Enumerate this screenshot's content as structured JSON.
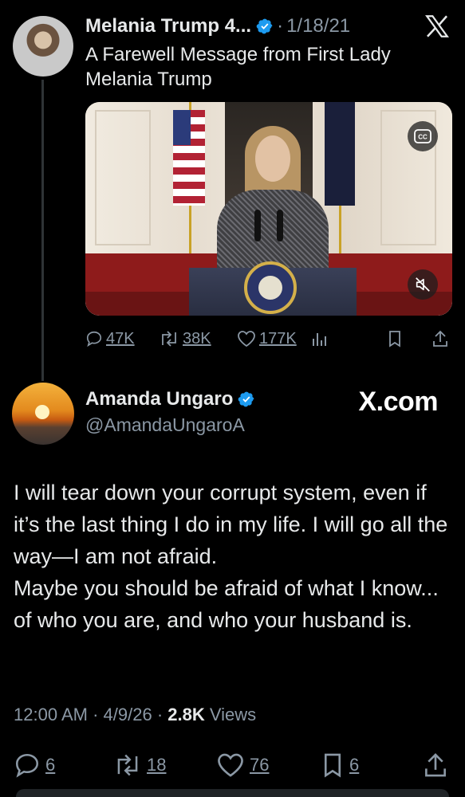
{
  "tweet1": {
    "author_name": "Melania Trump 4...",
    "separator": "·",
    "date": "1/18/21",
    "text": "A Farewell Message from First Lady Melania Trump",
    "replies": "47K",
    "reposts": "38K",
    "likes": "177K"
  },
  "tweet2": {
    "author_name": "Amanda Ungaro",
    "handle": "@AmandaUngaroA",
    "text": "I will tear down your corrupt system, even if it’s the last thing I do in my life. I will go all the way—I am not afraid.\nMaybe you should be afraid of what I know... of who you are, and who your husband is.",
    "time": "12:00 AM",
    "sep1": "·",
    "date": "4/9/26",
    "sep2": "·",
    "views_count": "2.8K",
    "views_label": "Views",
    "replies": "6",
    "reposts": "18",
    "likes": "76",
    "bookmarks": "6"
  },
  "watermark": "X.com",
  "colors": {
    "background": "#000000",
    "text": "#e7e9ea",
    "secondary": "#8b98a5",
    "verified": "#1d9bf0"
  },
  "icons": [
    "x-logo-icon",
    "verified-icon",
    "closed-captions-icon",
    "mute-icon",
    "reply-icon",
    "repost-icon",
    "like-icon",
    "views-icon",
    "bookmark-icon",
    "share-icon"
  ]
}
